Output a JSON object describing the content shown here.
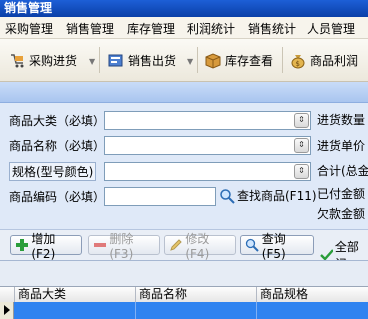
{
  "window": {
    "title": "销售管理"
  },
  "menu": [
    "采购管理",
    "销售管理",
    "库存管理",
    "利润统计",
    "销售统计",
    "人员管理"
  ],
  "toolbar": {
    "purchase_in": "采购进货",
    "sales_out": "销售出货",
    "stock_view": "库存查看",
    "profit": "商品利润"
  },
  "form": {
    "category_label": "商品大类（必填）",
    "name_label": "商品名称（必填）",
    "spec_label": "规格(型号颜色)",
    "code_label": "商品编码（必填）",
    "find_label": "查找商品(F11)",
    "qty_label": "进货数量",
    "unit_price_label": "进货单价",
    "total_label": "合计(总金",
    "paid_label": "已付金额",
    "owed_label": "欠款金额"
  },
  "actions": {
    "add": "增加(F2)",
    "delete": "删除(F3)",
    "edit": "修改(F4)",
    "query": "查询(F5)",
    "all": "全部记"
  },
  "grid": {
    "columns": [
      "商品大类",
      "商品名称",
      "商品规格"
    ]
  }
}
